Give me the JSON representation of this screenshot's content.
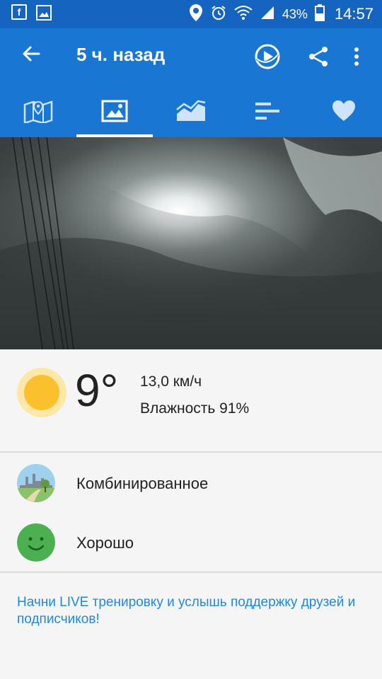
{
  "status_bar": {
    "battery": "43%",
    "time": "14:57",
    "left_icons": [
      "facebook-icon",
      "gallery-icon"
    ],
    "right_icons": [
      "location-icon",
      "alarm-icon",
      "wifi-icon",
      "signal-icon",
      "battery-icon"
    ]
  },
  "app_bar": {
    "title": "5 ч. назад",
    "actions": [
      "play-route-icon",
      "share-icon",
      "more-vert-icon"
    ]
  },
  "tabs": [
    {
      "icon": "map-icon",
      "active": false
    },
    {
      "icon": "photo-icon",
      "active": true
    },
    {
      "icon": "chart-icon",
      "active": false
    },
    {
      "icon": "list-icon",
      "active": false
    },
    {
      "icon": "heart-icon",
      "active": false
    }
  ],
  "weather": {
    "icon": "sun-icon",
    "temperature": "9°",
    "wind": "13,0 км/ч",
    "humidity": "Влажность 91%"
  },
  "surface": {
    "label": "Комбинированное",
    "icon": "surface-icon"
  },
  "feeling": {
    "label": "Хорошо",
    "icon": "smiley-icon"
  },
  "live_text": "Начни LIVE тренировку и услышь поддержку друзей и подписчиков!",
  "colors": {
    "statusbar": "#1565c0",
    "appbar": "#1976d2",
    "link": "#1e88e5",
    "smiley": "#4caf50"
  }
}
